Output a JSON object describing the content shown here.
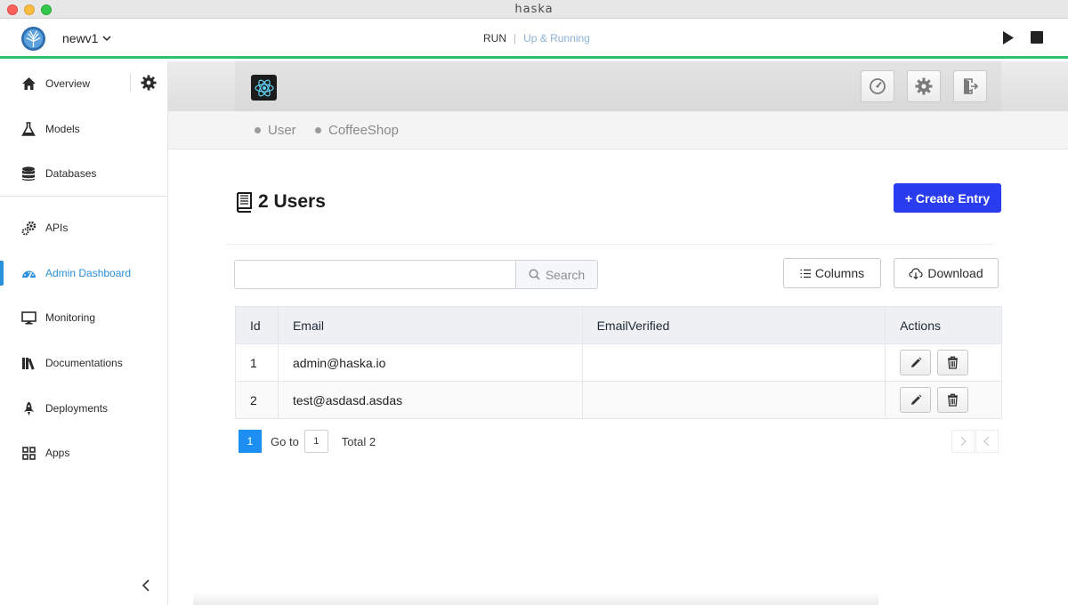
{
  "window": {
    "title": "haska"
  },
  "topbar": {
    "project_name": "newv1",
    "run_label": "RUN",
    "status_label": "Up & Running",
    "accent_color": "#2bc16a"
  },
  "sidebar": {
    "items": [
      {
        "label": "Overview",
        "icon": "home-icon"
      },
      {
        "label": "Models",
        "icon": "flask-icon"
      },
      {
        "label": "Databases",
        "icon": "database-icon"
      },
      {
        "label": "APIs",
        "icon": "gears-icon"
      },
      {
        "label": "Admin Dashboard",
        "icon": "dashboard-icon",
        "active": true
      },
      {
        "label": "Monitoring",
        "icon": "monitor-icon"
      },
      {
        "label": "Documentations",
        "icon": "books-icon"
      },
      {
        "label": "Deployments",
        "icon": "rocket-icon"
      },
      {
        "label": "Apps",
        "icon": "grid-icon"
      }
    ],
    "active_color": "#2c8fd9"
  },
  "tabs": [
    {
      "label": "User"
    },
    {
      "label": "CoffeeShop"
    }
  ],
  "main": {
    "title": "2 Users",
    "create_label": "+ Create Entry",
    "search_placeholder": "",
    "search_label": "Search",
    "columns_label": "Columns",
    "download_label": "Download"
  },
  "table": {
    "headers": [
      "Id",
      "Email",
      "EmailVerified",
      "Actions"
    ],
    "rows": [
      {
        "id": "1",
        "email": "admin@haska.io",
        "verified": ""
      },
      {
        "id": "2",
        "email": "test@asdasd.asdas",
        "verified": ""
      }
    ]
  },
  "pagination": {
    "current_page": "1",
    "goto_label": "Go to",
    "goto_value": "1",
    "total_label": "Total 2"
  }
}
